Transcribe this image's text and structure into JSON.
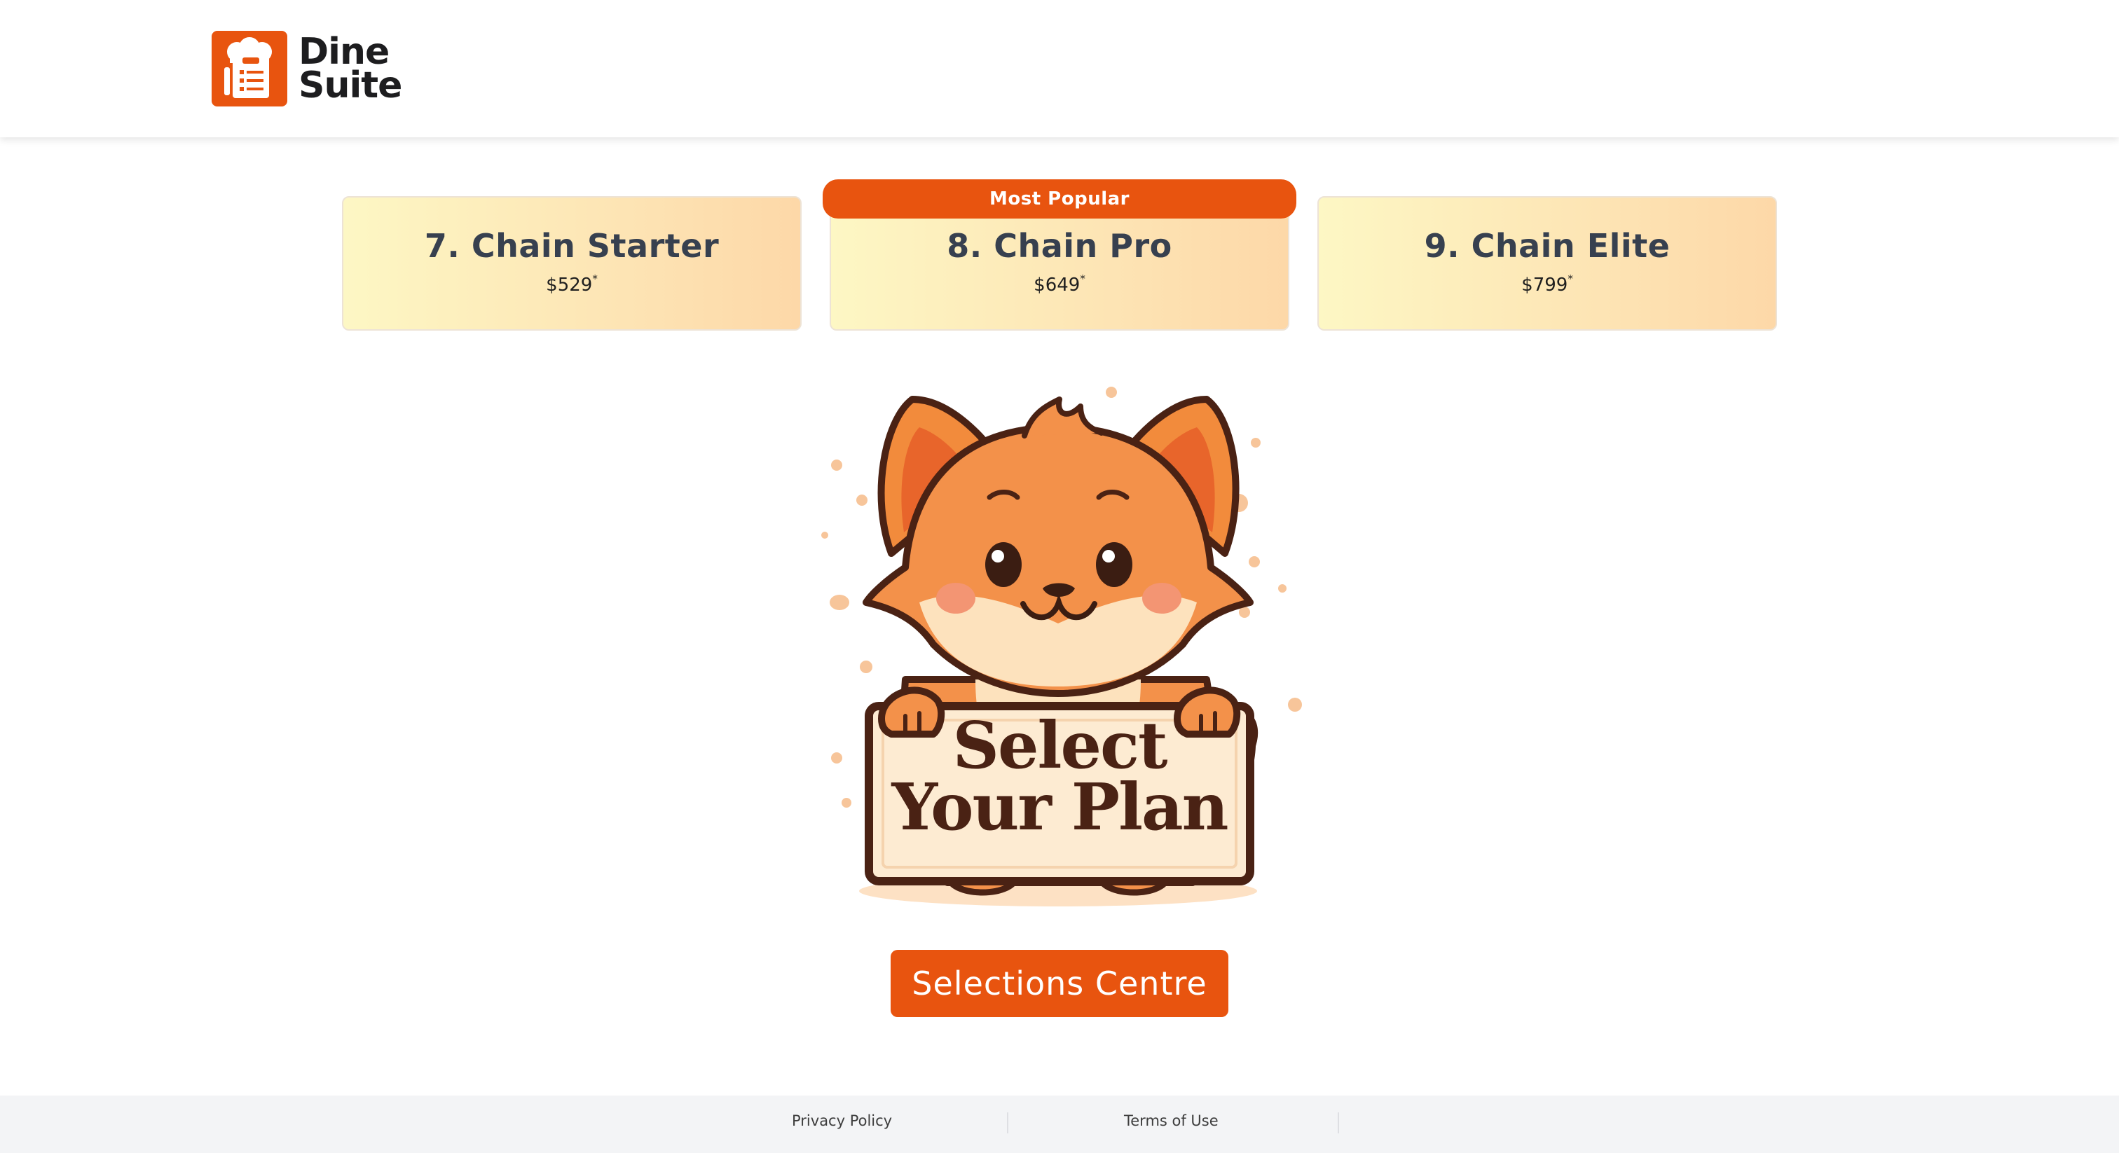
{
  "header": {
    "logo": {
      "line1": "Dine",
      "line2": "Suite",
      "icon": "chef-hat-clipboard-icon"
    }
  },
  "plans": [
    {
      "name": "7. Chain Starter",
      "price": "$529",
      "price_mark": "*"
    },
    {
      "name": "8. Chain Pro",
      "price": "$649",
      "price_mark": "*",
      "badge": "Most Popular"
    },
    {
      "name": "9. Chain Elite",
      "price": "$799",
      "price_mark": "*"
    }
  ],
  "hero": {
    "image": "fox-mascot-holding-sign",
    "sign_line1": "Select",
    "sign_line2": "Your Plan"
  },
  "cta": {
    "label": "Selections Centre"
  },
  "footer": {
    "links": [
      "Privacy Policy",
      "Terms of Use"
    ]
  },
  "colors": {
    "accent": "#e8540f",
    "heading": "#37404f",
    "card_gradient_start": "#fdf7c4",
    "card_gradient_end": "#fdd8a8",
    "footer_bg": "#f3f4f6"
  }
}
